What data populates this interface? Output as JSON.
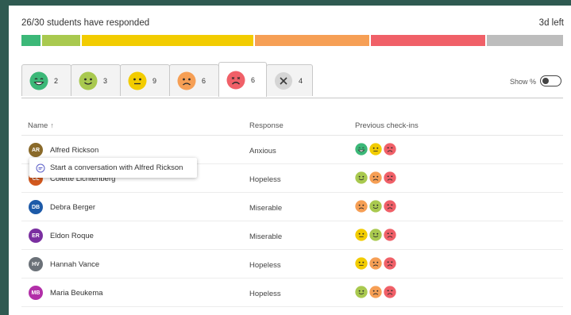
{
  "header": {
    "status": "26/30 students have responded",
    "time_left": "3d left"
  },
  "progress_segments": [
    {
      "color": "#3cb878",
      "value": 1
    },
    {
      "color": "#a9c94f",
      "value": 2
    },
    {
      "color": "#f2cc00",
      "value": 9
    },
    {
      "color": "#f69f55",
      "value": 6
    },
    {
      "color": "#f06068",
      "value": 6
    },
    {
      "color": "#bdbdbd",
      "value": 4
    }
  ],
  "tabs": [
    {
      "icon": "very-happy-face-icon",
      "count": "2",
      "color": "#3cb878"
    },
    {
      "icon": "happy-face-icon",
      "count": "3",
      "color": "#a9c94f"
    },
    {
      "icon": "neutral-face-icon",
      "count": "9",
      "color": "#f2cc00"
    },
    {
      "icon": "sad-face-icon",
      "count": "6",
      "color": "#f69f55"
    },
    {
      "icon": "very-sad-face-icon",
      "count": "6",
      "color": "#f06068"
    },
    {
      "icon": "no-response-icon",
      "count": "4",
      "color": "#d5d5d5"
    }
  ],
  "show_percent": {
    "label": "Show %",
    "on": false
  },
  "columns": {
    "name": "Name",
    "sort": "↑",
    "response": "Response",
    "previous": "Previous check-ins"
  },
  "tooltip": {
    "text": "Start a conversation with Alfred Rickson"
  },
  "students": [
    {
      "initials": "AR",
      "name": "Alfred Rickson",
      "avatar_color": "#8a6a2a",
      "response": "Anxious",
      "previous": [
        "very-happy",
        "neutral",
        "very-sad"
      ]
    },
    {
      "initials": "CL",
      "name": "Colette Lichtenberg",
      "avatar_color": "#d2581e",
      "response": "Hopeless",
      "previous": [
        "happy",
        "sad",
        "very-sad"
      ]
    },
    {
      "initials": "DB",
      "name": "Debra Berger",
      "avatar_color": "#1d5aa8",
      "response": "Miserable",
      "previous": [
        "sad",
        "happy",
        "very-sad"
      ]
    },
    {
      "initials": "ER",
      "name": "Eldon Roque",
      "avatar_color": "#7a2fa0",
      "response": "Miserable",
      "previous": [
        "neutral",
        "happy",
        "very-sad"
      ]
    },
    {
      "initials": "HV",
      "name": "Hannah Vance",
      "avatar_color": "#6b7178",
      "response": "Hopeless",
      "previous": [
        "neutral",
        "sad",
        "very-sad"
      ]
    },
    {
      "initials": "MB",
      "name": "Maria Beukema",
      "avatar_color": "#b22fa8",
      "response": "Hopeless",
      "previous": [
        "happy",
        "sad",
        "very-sad"
      ]
    }
  ]
}
